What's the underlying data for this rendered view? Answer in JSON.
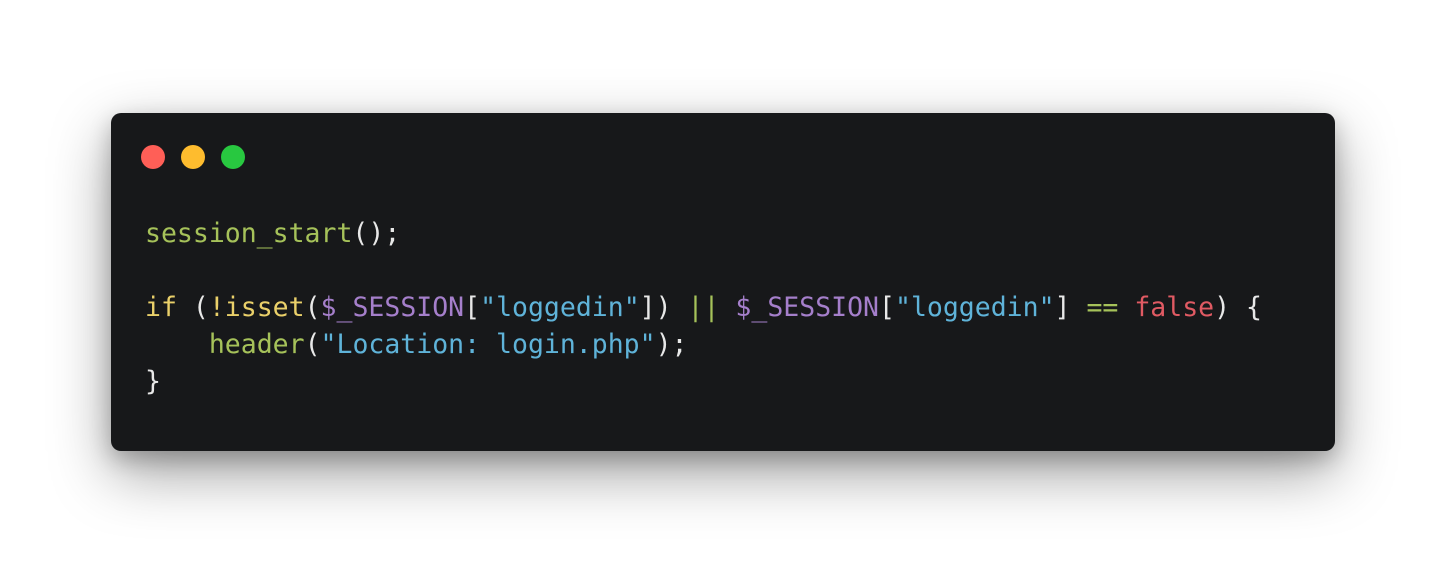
{
  "window": {
    "controls": [
      {
        "name": "close",
        "color": "#ff5f57"
      },
      {
        "name": "minimize",
        "color": "#febc2e"
      },
      {
        "name": "zoom",
        "color": "#28c840"
      }
    ]
  },
  "colors": {
    "background": "#17181a",
    "text": "#e8e8e8",
    "function": "#a6c25a",
    "keyword": "#ead06a",
    "variable": "#a57fcb",
    "string": "#5fb3d9",
    "operator": "#a6c25a",
    "boolean": "#e05a63"
  },
  "code": {
    "lines": [
      [
        {
          "t": "session_start",
          "k": "function"
        },
        {
          "t": "();",
          "k": "text"
        }
      ],
      [],
      [
        {
          "t": "if",
          "k": "keyword"
        },
        {
          "t": " (",
          "k": "text"
        },
        {
          "t": "!isset",
          "k": "keyword"
        },
        {
          "t": "(",
          "k": "text"
        },
        {
          "t": "$_SESSION",
          "k": "variable"
        },
        {
          "t": "[",
          "k": "text"
        },
        {
          "t": "\"loggedin\"",
          "k": "string"
        },
        {
          "t": "]) ",
          "k": "text"
        },
        {
          "t": "||",
          "k": "operator"
        },
        {
          "t": " ",
          "k": "text"
        },
        {
          "t": "$_SESSION",
          "k": "variable"
        },
        {
          "t": "[",
          "k": "text"
        },
        {
          "t": "\"loggedin\"",
          "k": "string"
        },
        {
          "t": "] ",
          "k": "text"
        },
        {
          "t": "==",
          "k": "operator"
        },
        {
          "t": " ",
          "k": "text"
        },
        {
          "t": "false",
          "k": "boolean"
        },
        {
          "t": ") {",
          "k": "text"
        }
      ],
      [
        {
          "t": "    ",
          "k": "text"
        },
        {
          "t": "header",
          "k": "function"
        },
        {
          "t": "(",
          "k": "text"
        },
        {
          "t": "\"Location: login.php\"",
          "k": "string"
        },
        {
          "t": ");",
          "k": "text"
        }
      ],
      [
        {
          "t": "}",
          "k": "text"
        }
      ]
    ]
  }
}
